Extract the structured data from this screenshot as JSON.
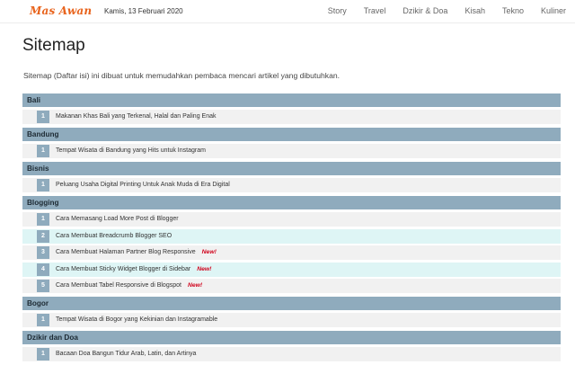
{
  "header": {
    "logo": "Mas Awan",
    "date": "Kamis, 13 Februari 2020",
    "nav": [
      "Story",
      "Travel",
      "Dzikir & Doa",
      "Kisah",
      "Tekno",
      "Kuliner"
    ]
  },
  "page": {
    "title": "Sitemap",
    "intro": "Sitemap (Daftar isi) ini dibuat untuk memudahkan pembaca mencari artikel yang dibutuhkan."
  },
  "categories": [
    {
      "name": "Bali",
      "items": [
        {
          "num": "1",
          "title": "Makanan Khas Bali yang Terkenal, Halal dan Paling Enak",
          "badge": ""
        }
      ]
    },
    {
      "name": "Bandung",
      "items": [
        {
          "num": "1",
          "title": "Tempat Wisata di Bandung yang Hits untuk Instagram",
          "badge": ""
        }
      ]
    },
    {
      "name": "Bisnis",
      "items": [
        {
          "num": "1",
          "title": "Peluang Usaha Digital Printing Untuk Anak Muda di Era Digital",
          "badge": ""
        }
      ]
    },
    {
      "name": "Blogging",
      "items": [
        {
          "num": "1",
          "title": "Cara Memasang Load More Post di Blogger",
          "badge": ""
        },
        {
          "num": "2",
          "title": "Cara Membuat Breadcrumb Blogger SEO",
          "badge": ""
        },
        {
          "num": "3",
          "title": "Cara Membuat Halaman Partner Blog Responsive",
          "badge": "New!"
        },
        {
          "num": "4",
          "title": "Cara Membuat Sticky Widget Blogger di Sidebar",
          "badge": "New!"
        },
        {
          "num": "5",
          "title": "Cara Membuat Tabel Responsive di Blogspot",
          "badge": "New!"
        }
      ]
    },
    {
      "name": "Bogor",
      "items": [
        {
          "num": "1",
          "title": "Tempat Wisata di Bogor yang Kekinian dan Instagramable",
          "badge": ""
        }
      ]
    },
    {
      "name": "Dzikir dan Doa",
      "items": [
        {
          "num": "1",
          "title": "Bacaan Doa Bangun Tidur Arab, Latin, dan Artinya",
          "badge": ""
        }
      ]
    }
  ],
  "colors": {
    "logo": "#e8631c",
    "header_bg": "#8fabbd",
    "new_badge": "#d0021b",
    "row_bg": "#f1f1f1",
    "row_alt_bg": "#def5f5"
  }
}
